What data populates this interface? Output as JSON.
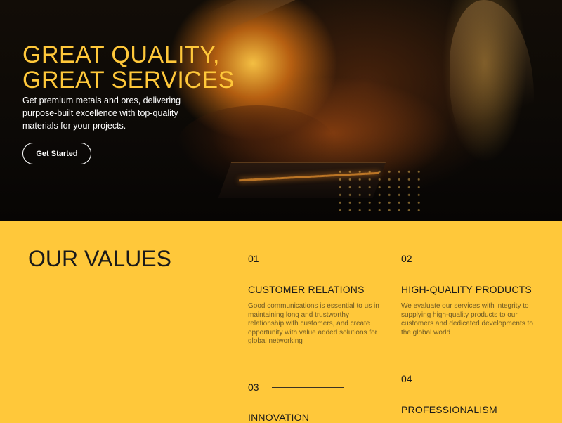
{
  "hero": {
    "title_line1": "GREAT QUALITY,",
    "title_line2": "GREAT SERVICES",
    "subtitle": "Get premium metals and ores, delivering purpose-built excellence with top-quality materials for your projects.",
    "cta_label": "Get Started"
  },
  "values": {
    "title": "OUR VALUES",
    "items": [
      {
        "number": "01",
        "heading": "CUSTOMER RELATIONS",
        "description": "Good communications is essential to us in maintaining long and trustworthy relationship with customers, and create opportunity with value added solutions for global networking"
      },
      {
        "number": "02",
        "heading": "HIGH-QUALITY PRODUCTS",
        "description": "We evaluate our services with integrity to supplying high-quality products to our customers and dedicated developments to the global world"
      },
      {
        "number": "03",
        "heading": "INNOVATION",
        "description": ""
      },
      {
        "number": "04",
        "heading": "PROFESSIONALISM",
        "description": ""
      }
    ]
  },
  "colors": {
    "accent": "#ffc83a",
    "hero_bg": "#0c0906",
    "text_dark": "#1a1a1a"
  }
}
